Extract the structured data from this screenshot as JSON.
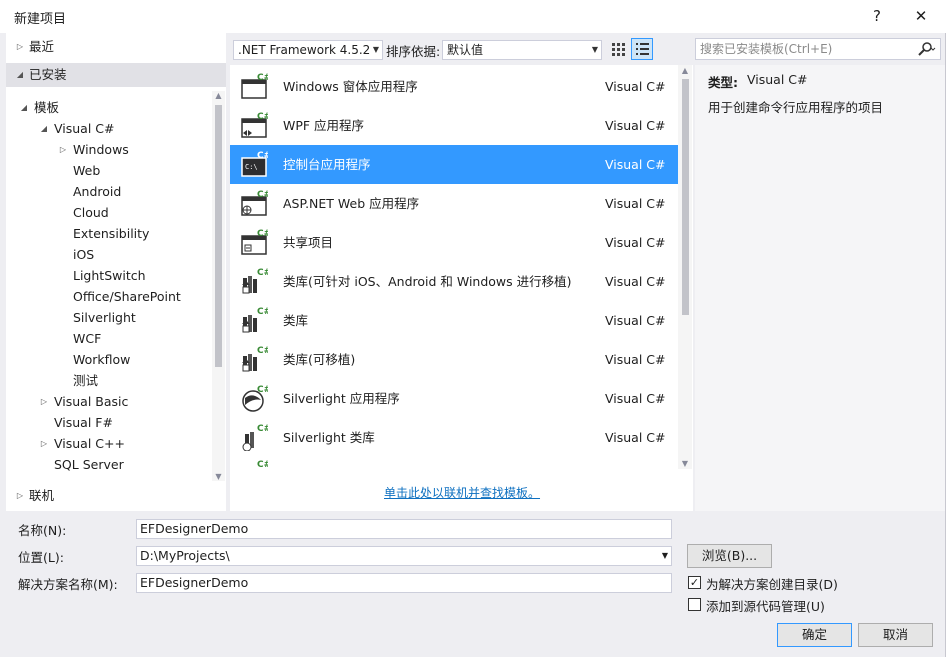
{
  "window": {
    "title": "新建项目",
    "help_label": "?",
    "close_label": "✕"
  },
  "left": {
    "recent_label": "最近",
    "installed_label": "已安装",
    "online_label": "联机",
    "tree": [
      {
        "label": "模板",
        "indent": 0,
        "expander": "open"
      },
      {
        "label": "Visual C#",
        "indent": 1,
        "expander": "open"
      },
      {
        "label": "Windows",
        "indent": 2,
        "expander": "closed"
      },
      {
        "label": "Web",
        "indent": 2,
        "expander": "none"
      },
      {
        "label": "Android",
        "indent": 2,
        "expander": "none"
      },
      {
        "label": "Cloud",
        "indent": 2,
        "expander": "none"
      },
      {
        "label": "Extensibility",
        "indent": 2,
        "expander": "none"
      },
      {
        "label": "iOS",
        "indent": 2,
        "expander": "none"
      },
      {
        "label": "LightSwitch",
        "indent": 2,
        "expander": "none"
      },
      {
        "label": "Office/SharePoint",
        "indent": 2,
        "expander": "none"
      },
      {
        "label": "Silverlight",
        "indent": 2,
        "expander": "none"
      },
      {
        "label": "WCF",
        "indent": 2,
        "expander": "none"
      },
      {
        "label": "Workflow",
        "indent": 2,
        "expander": "none"
      },
      {
        "label": "测试",
        "indent": 2,
        "expander": "none"
      },
      {
        "label": "Visual Basic",
        "indent": 1,
        "expander": "closed"
      },
      {
        "label": "Visual F#",
        "indent": 1,
        "expander": "none"
      },
      {
        "label": "Visual C++",
        "indent": 1,
        "expander": "closed"
      },
      {
        "label": "SQL Server",
        "indent": 1,
        "expander": "none"
      }
    ]
  },
  "toolbar": {
    "framework": ".NET Framework 4.5.2",
    "sort_label": "排序依据:",
    "sort_value": "默认值"
  },
  "search": {
    "placeholder": "搜索已安装模板(Ctrl+E)"
  },
  "templates": [
    {
      "name": "Windows 窗体应用程序",
      "lang": "Visual C#",
      "icon": "windows-forms-icon",
      "selected": false
    },
    {
      "name": "WPF 应用程序",
      "lang": "Visual C#",
      "icon": "wpf-app-icon",
      "selected": false
    },
    {
      "name": "控制台应用程序",
      "lang": "Visual C#",
      "icon": "console-app-icon",
      "selected": true
    },
    {
      "name": "ASP.NET Web 应用程序",
      "lang": "Visual C#",
      "icon": "web-app-icon",
      "selected": false
    },
    {
      "name": "共享项目",
      "lang": "Visual C#",
      "icon": "shared-project-icon",
      "selected": false
    },
    {
      "name": "类库(可针对 iOS、Android 和 Windows 进行移植)",
      "lang": "Visual C#",
      "icon": "portable-library-icon",
      "selected": false
    },
    {
      "name": "类库",
      "lang": "Visual C#",
      "icon": "class-library-icon",
      "selected": false
    },
    {
      "name": "类库(可移植)",
      "lang": "Visual C#",
      "icon": "portable-class-library-icon",
      "selected": false
    },
    {
      "name": "Silverlight 应用程序",
      "lang": "Visual C#",
      "icon": "silverlight-app-icon",
      "selected": false
    },
    {
      "name": "Silverlight 类库",
      "lang": "Visual C#",
      "icon": "silverlight-library-icon",
      "selected": false
    }
  ],
  "online_link": "单击此处以联机并查找模板。",
  "details": {
    "type_label": "类型:",
    "type_value": "Visual C#",
    "description": "用于创建命令行应用程序的项目"
  },
  "form": {
    "name_label": "名称(N):",
    "name_value": "EFDesignerDemo",
    "location_label": "位置(L):",
    "location_value": "D:\\MyProjects\\",
    "solution_label": "解决方案名称(M):",
    "solution_value": "EFDesignerDemo",
    "browse_label": "浏览(B)...",
    "create_dir_label": "为解决方案创建目录(D)",
    "create_dir_checked": true,
    "source_control_label": "添加到源代码管理(U)",
    "source_control_checked": false,
    "ok_label": "确定",
    "cancel_label": "取消"
  },
  "colors": {
    "accent": "#3399ff",
    "link": "#0e70c0",
    "csharp_badge": "#388a34"
  }
}
